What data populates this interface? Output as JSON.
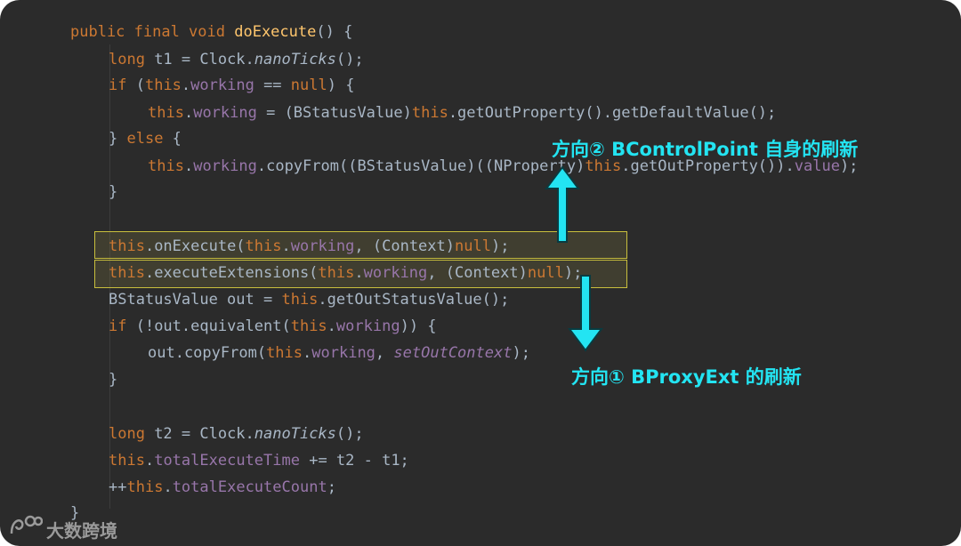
{
  "code_lines": [
    {
      "tokens": [
        {
          "t": "public final void ",
          "c": "kw"
        },
        {
          "t": "doExecute",
          "c": "fn"
        },
        {
          "t": "() {",
          "c": ""
        }
      ]
    },
    {
      "tokens": [
        {
          "t": "long ",
          "c": "kw"
        },
        {
          "t": "t1 = Clock.",
          "c": ""
        },
        {
          "t": "nanoTicks",
          "c": "it"
        },
        {
          "t": "();",
          "c": ""
        }
      ]
    },
    {
      "tokens": [
        {
          "t": "if ",
          "c": "kw"
        },
        {
          "t": "(",
          "c": ""
        },
        {
          "t": "this",
          "c": "kw"
        },
        {
          "t": ".",
          "c": ""
        },
        {
          "t": "working",
          "c": "fld"
        },
        {
          "t": " == ",
          "c": ""
        },
        {
          "t": "null",
          "c": "kw"
        },
        {
          "t": ") {",
          "c": ""
        }
      ]
    },
    {
      "tokens": [
        {
          "t": "this",
          "c": "kw"
        },
        {
          "t": ".",
          "c": ""
        },
        {
          "t": "working",
          "c": "fld"
        },
        {
          "t": " = (BStatusValue)",
          "c": ""
        },
        {
          "t": "this",
          "c": "kw"
        },
        {
          "t": ".getOutProperty().getDefaultValue();",
          "c": ""
        }
      ]
    },
    {
      "tokens": [
        {
          "t": "} ",
          "c": ""
        },
        {
          "t": "else",
          "c": "kw"
        },
        {
          "t": " {",
          "c": ""
        }
      ]
    },
    {
      "tokens": [
        {
          "t": "this",
          "c": "kw"
        },
        {
          "t": ".",
          "c": ""
        },
        {
          "t": "working",
          "c": "fld"
        },
        {
          "t": ".copyFrom((BStatusValue)((NProperty)",
          "c": ""
        },
        {
          "t": "this",
          "c": "kw"
        },
        {
          "t": ".getOutProperty()).",
          "c": ""
        },
        {
          "t": "value",
          "c": "fld"
        },
        {
          "t": ");",
          "c": ""
        }
      ]
    },
    {
      "tokens": [
        {
          "t": "}",
          "c": ""
        }
      ]
    },
    {
      "tokens": [
        {
          "t": "this",
          "c": "kw"
        },
        {
          "t": ".onExecute(",
          "c": ""
        },
        {
          "t": "this",
          "c": "kw"
        },
        {
          "t": ".",
          "c": ""
        },
        {
          "t": "working",
          "c": "fld"
        },
        {
          "t": ", (Context)",
          "c": ""
        },
        {
          "t": "null",
          "c": "kw"
        },
        {
          "t": ");",
          "c": ""
        }
      ]
    },
    {
      "tokens": [
        {
          "t": "this",
          "c": "kw"
        },
        {
          "t": ".executeExtensions(",
          "c": ""
        },
        {
          "t": "this",
          "c": "kw"
        },
        {
          "t": ".",
          "c": ""
        },
        {
          "t": "working",
          "c": "fld"
        },
        {
          "t": ", (Context)",
          "c": ""
        },
        {
          "t": "null",
          "c": "kw"
        },
        {
          "t": ");",
          "c": ""
        }
      ]
    },
    {
      "tokens": [
        {
          "t": "BStatusValue out = ",
          "c": ""
        },
        {
          "t": "this",
          "c": "kw"
        },
        {
          "t": ".getOutStatusValue();",
          "c": ""
        }
      ]
    },
    {
      "tokens": [
        {
          "t": "if ",
          "c": "kw"
        },
        {
          "t": "(!out.equivalent(",
          "c": ""
        },
        {
          "t": "this",
          "c": "kw"
        },
        {
          "t": ".",
          "c": ""
        },
        {
          "t": "working",
          "c": "fld"
        },
        {
          "t": ")) {",
          "c": ""
        }
      ]
    },
    {
      "tokens": [
        {
          "t": "out.copyFrom(",
          "c": ""
        },
        {
          "t": "this",
          "c": "kw"
        },
        {
          "t": ".",
          "c": ""
        },
        {
          "t": "working",
          "c": "fld"
        },
        {
          "t": ", ",
          "c": ""
        },
        {
          "t": "setOutContext",
          "c": "itf"
        },
        {
          "t": ");",
          "c": ""
        }
      ]
    },
    {
      "tokens": [
        {
          "t": "}",
          "c": ""
        }
      ]
    },
    {
      "tokens": [
        {
          "t": "long ",
          "c": "kw"
        },
        {
          "t": "t2 = Clock.",
          "c": ""
        },
        {
          "t": "nanoTicks",
          "c": "it"
        },
        {
          "t": "();",
          "c": ""
        }
      ]
    },
    {
      "tokens": [
        {
          "t": "this",
          "c": "kw"
        },
        {
          "t": ".",
          "c": ""
        },
        {
          "t": "totalExecuteTime",
          "c": "fld"
        },
        {
          "t": " += t2 - t1;",
          "c": ""
        }
      ]
    },
    {
      "tokens": [
        {
          "t": "++",
          "c": ""
        },
        {
          "t": "this",
          "c": "kw"
        },
        {
          "t": ".",
          "c": ""
        },
        {
          "t": "totalExecuteCount",
          "c": "fld"
        },
        {
          "t": ";",
          "c": ""
        }
      ]
    },
    {
      "tokens": [
        {
          "t": "}",
          "c": ""
        }
      ]
    }
  ],
  "annotations": {
    "direction2": "方向② BControlPoint 自身的刷新",
    "direction1": "方向① BProxyExt 的刷新"
  },
  "watermark": "大数跨境",
  "colors": {
    "background": "#2b2b2b",
    "keyword": "#cc7832",
    "method": "#ffc66d",
    "field": "#9876aa",
    "text": "#a9b7c6",
    "annotation": "#23e4f2",
    "highlight_border": "#c9bf3d"
  }
}
